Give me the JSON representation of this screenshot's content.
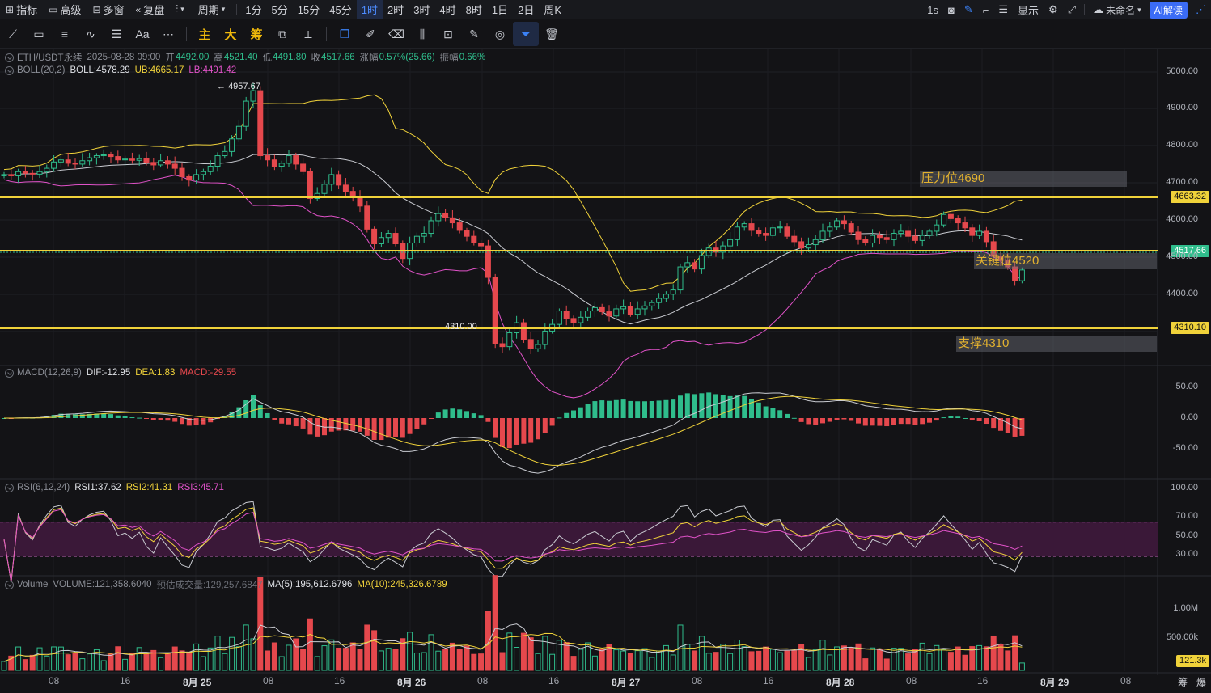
{
  "topbar": {
    "indicators": "指标",
    "advanced": "高级",
    "multi_window": "多窗",
    "replay": "复盘",
    "period": "周期",
    "timeframes": [
      "1分",
      "5分",
      "15分",
      "45分",
      "1时",
      "2时",
      "3时",
      "4时",
      "8时",
      "1日",
      "2日",
      "周K"
    ],
    "active_timeframe": "1时",
    "right": {
      "interval": "1s",
      "display": "显示",
      "unnamed": "未命名",
      "ai": "AI解读"
    }
  },
  "drawbar": {
    "main": "主",
    "big": "大",
    "chips": "筹",
    "text": "Aa"
  },
  "legend": {
    "symbol": "ETH/USDT永续",
    "time": "2025-08-28 09:00",
    "open_label": "开",
    "open": "4492.00",
    "high_label": "高",
    "high": "4521.40",
    "low_label": "低",
    "low": "4491.80",
    "close_label": "收",
    "close": "4517.66",
    "change_label": "涨幅",
    "change": "0.57%(25.66)",
    "amp_label": "振幅",
    "amp": "0.66%"
  },
  "boll": {
    "name": "BOLL(20,2)",
    "boll": "BOLL:4578.29",
    "ub": "UB:4665.17",
    "lb": "LB:4491.42"
  },
  "macd": {
    "name": "MACD(12,26,9)",
    "dif": "DIF:-12.95",
    "dea": "DEA:1.83",
    "macd": "MACD:-29.55"
  },
  "rsi": {
    "name": "RSI(6,12,24)",
    "rsi1": "RSI1:37.62",
    "rsi2": "RSI2:41.31",
    "rsi3": "RSI3:45.71"
  },
  "volume": {
    "name": "Volume",
    "vol": "VOLUME:121,358.6040",
    "est": "预估成交量:129,257.6847",
    "ma5": "MA(5):195,612.6796",
    "ma10": "MA(10):245,326.6789"
  },
  "annotations": {
    "resistance": "压力位4690",
    "key": "关键位4520",
    "support": "支撑4310",
    "high": "4957.67",
    "low": "4310.00"
  },
  "price_tags": {
    "resistance": "4663.32",
    "current": "4517.66",
    "support": "4310.10",
    "volume": "121.3k"
  },
  "price_axis": [
    "5000.00",
    "4900.00",
    "4800.00",
    "4700.00",
    "4600.00",
    "4500.00",
    "4400.00"
  ],
  "macd_axis": [
    "50.00",
    "0.00",
    "-50.00"
  ],
  "rsi_axis": [
    "100.00",
    "70.00",
    "50.00",
    "30.00"
  ],
  "vol_axis": [
    "1.00M",
    "500.00k"
  ],
  "time_axis": [
    {
      "t": "08",
      "b": false
    },
    {
      "t": "16",
      "b": false
    },
    {
      "t": "8月 25",
      "b": true
    },
    {
      "t": "08",
      "b": false
    },
    {
      "t": "16",
      "b": false
    },
    {
      "t": "8月 26",
      "b": true
    },
    {
      "t": "08",
      "b": false
    },
    {
      "t": "16",
      "b": false
    },
    {
      "t": "8月 27",
      "b": true
    },
    {
      "t": "08",
      "b": false
    },
    {
      "t": "16",
      "b": false
    },
    {
      "t": "8月 28",
      "b": true
    },
    {
      "t": "08",
      "b": false
    },
    {
      "t": "16",
      "b": false
    },
    {
      "t": "8月 29",
      "b": true
    },
    {
      "t": "08",
      "b": false
    }
  ],
  "corner": {
    "chips": "筹",
    "burst": "爆"
  },
  "chart_data": {
    "type": "candlestick",
    "symbol": "ETH/USDT永续",
    "interval": "1时",
    "ylim": [
      4290,
      5030
    ],
    "horizontal_lines": [
      4663.32,
      4517.66,
      4310.1
    ],
    "closes": [
      4745,
      4742,
      4752,
      4748,
      4746,
      4752,
      4760,
      4775,
      4780,
      4772,
      4770,
      4778,
      4785,
      4790,
      4792,
      4788,
      4780,
      4782,
      4779,
      4783,
      4774,
      4768,
      4778,
      4770,
      4760,
      4740,
      4732,
      4745,
      4752,
      4765,
      4790,
      4800,
      4830,
      4860,
      4920,
      4945,
      4790,
      4780,
      4765,
      4772,
      4790,
      4770,
      4752,
      4688,
      4700,
      4722,
      4745,
      4720,
      4705,
      4690,
      4670,
      4615,
      4580,
      4595,
      4605,
      4580,
      4545,
      4582,
      4598,
      4605,
      4635,
      4652,
      4642,
      4630,
      4612,
      4598,
      4582,
      4575,
      4500,
      4342,
      4335,
      4368,
      4392,
      4352,
      4330,
      4340,
      4372,
      4388,
      4420,
      4402,
      4392,
      4405,
      4420,
      4428,
      4418,
      4408,
      4425,
      4430,
      4412,
      4425,
      4432,
      4440,
      4450,
      4460,
      4470,
      4525,
      4535,
      4520,
      4552,
      4570,
      4560,
      4575,
      4590,
      4620,
      4628,
      4612,
      4605,
      4600,
      4618,
      4620,
      4598,
      4585,
      4570,
      4578,
      4590,
      4610,
      4620,
      4635,
      4628,
      4608,
      4590,
      4582,
      4600,
      4595,
      4590,
      4605,
      4610,
      4598,
      4588,
      4600,
      4610,
      4625,
      4650,
      4640,
      4630,
      4618,
      4600,
      4610,
      4585,
      4550,
      4540,
      4525,
      4492,
      4517.66
    ],
    "boll": {
      "mid_last": 4578.29,
      "ub_last": 4665.17,
      "lb_last": 4491.42
    },
    "macd_last": {
      "dif": -12.95,
      "dea": 1.83,
      "macd": -29.55
    },
    "rsi_last": {
      "rsi1": 37.62,
      "rsi2": 41.31,
      "rsi3": 45.71
    },
    "volume_last": 121358.604,
    "volume_ma5": 195612.6796,
    "volume_ma10": 245326.6789
  }
}
